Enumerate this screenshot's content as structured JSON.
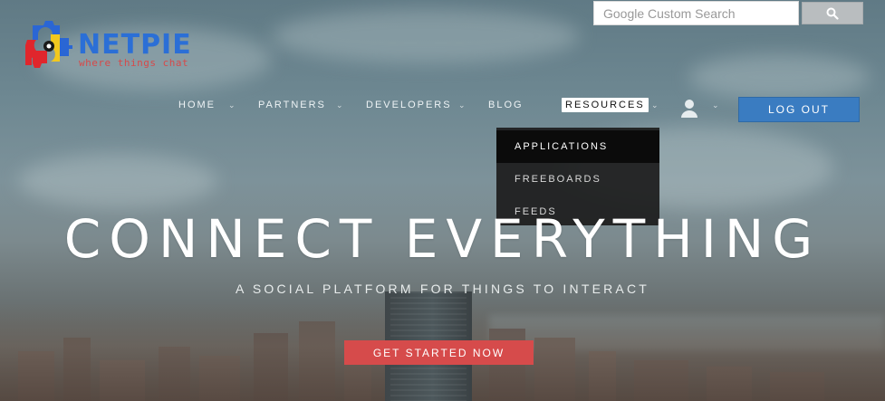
{
  "search": {
    "placeholder": "Google Custom Search",
    "button_icon": "search-icon"
  },
  "logo": {
    "name": "NETPIE",
    "tagline": "where things chat",
    "colors": {
      "text": "#2b6fd6",
      "tagline": "#d64a4a",
      "gear_red": "#e0262c",
      "gear_blue": "#2a66d4",
      "gear_yellow": "#f2c81e"
    }
  },
  "nav": {
    "items": [
      {
        "label": "HOME",
        "has_caret": true
      },
      {
        "label": "PARTNERS",
        "has_caret": true
      },
      {
        "label": "DEVELOPERS",
        "has_caret": true
      },
      {
        "label": "BLOG",
        "has_caret": false
      },
      {
        "label": "RESOURCES",
        "has_caret": true,
        "active": true
      }
    ],
    "user_icon": "user-icon",
    "logout_label": "LOG OUT"
  },
  "dropdown": {
    "items": [
      {
        "label": "APPLICATIONS",
        "selected": true
      },
      {
        "label": "FREEBOARDS",
        "selected": false
      },
      {
        "label": "FEEDS",
        "selected": false
      }
    ]
  },
  "hero": {
    "headline": "CONNECT EVERYTHING",
    "subhead": "A SOCIAL PLATFORM FOR THINGS TO INTERACT",
    "cta_label": "GET STARTED NOW"
  },
  "colors": {
    "accent_blue": "#3a7cc1",
    "cta_red": "#d64b4b"
  }
}
